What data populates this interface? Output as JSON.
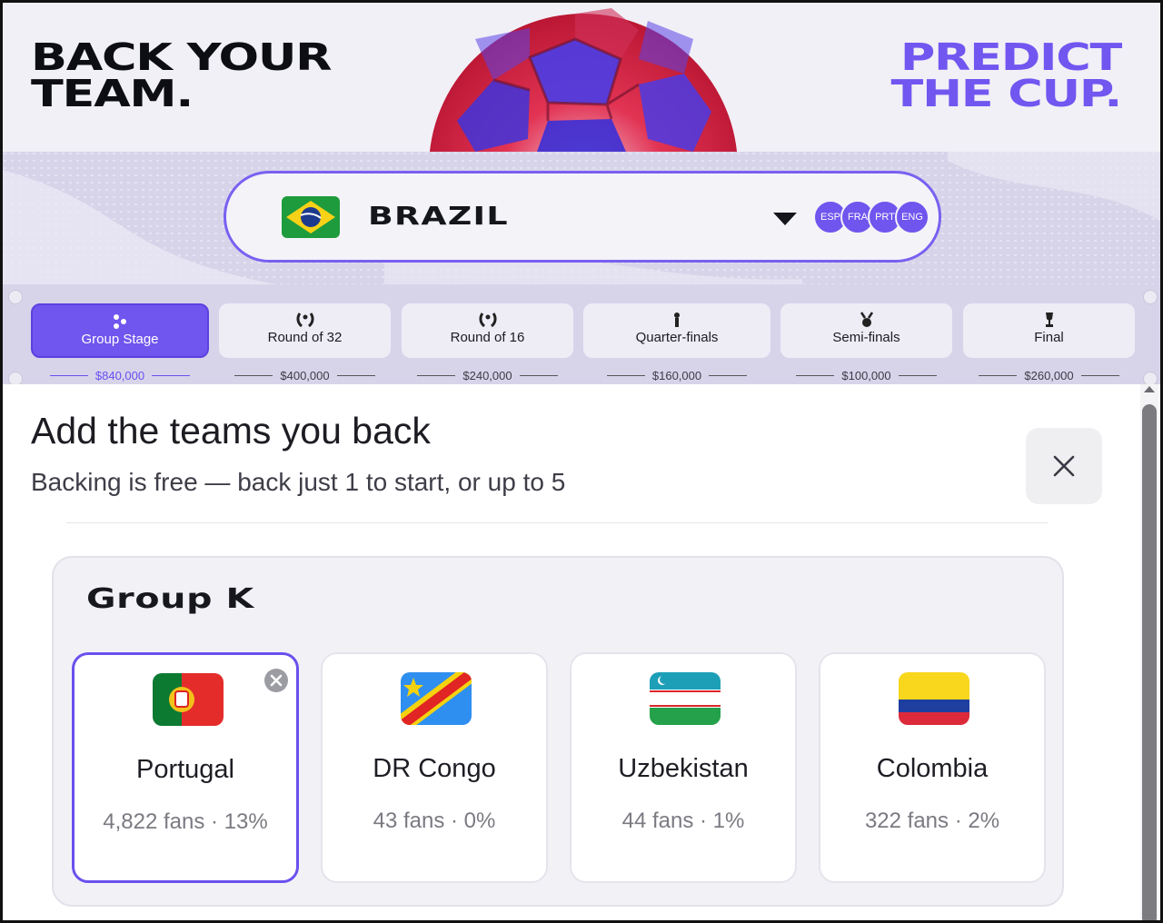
{
  "hero": {
    "left_line1": "BACK YOUR",
    "left_line2": "TEAM.",
    "right_line1": "PREDICT",
    "right_line2": "THE CUP."
  },
  "team_select": {
    "team": "BRAZIL",
    "flag_icon": "brazil-flag",
    "chips": [
      "ESP",
      "FRA",
      "PRT",
      "ENG"
    ]
  },
  "stages": [
    {
      "label": "Group Stage",
      "prize": "$840,000",
      "active": true,
      "icon": "group-dots-icon"
    },
    {
      "label": "Round of 32",
      "prize": "$400,000",
      "active": false,
      "icon": "laurel-icon"
    },
    {
      "label": "Round of 16",
      "prize": "$240,000",
      "active": false,
      "icon": "laurel-icon"
    },
    {
      "label": "Quarter-finals",
      "prize": "$160,000",
      "active": false,
      "icon": "torch-icon"
    },
    {
      "label": "Semi-finals",
      "prize": "$100,000",
      "active": false,
      "icon": "medal-icon"
    },
    {
      "label": "Final",
      "prize": "$260,000",
      "active": false,
      "icon": "trophy-icon"
    }
  ],
  "panel": {
    "title": "Add the teams you back",
    "subtitle": "Backing is free — back just 1 to start, or up to 5"
  },
  "group": {
    "name": "Group K",
    "teams": [
      {
        "name": "Portugal",
        "stats": "4,822 fans · 13%",
        "selected": true,
        "flag_icon": "portugal-flag"
      },
      {
        "name": "DR Congo",
        "stats": "43 fans · 0%",
        "selected": false,
        "flag_icon": "dr-congo-flag"
      },
      {
        "name": "Uzbekistan",
        "stats": "44 fans · 1%",
        "selected": false,
        "flag_icon": "uzbekistan-flag"
      },
      {
        "name": "Colombia",
        "stats": "322 fans · 2%",
        "selected": false,
        "flag_icon": "colombia-flag"
      }
    ]
  },
  "colors": {
    "accent": "#7055ee",
    "hero_right": "#7256f0",
    "band": "#d7d4ea"
  }
}
